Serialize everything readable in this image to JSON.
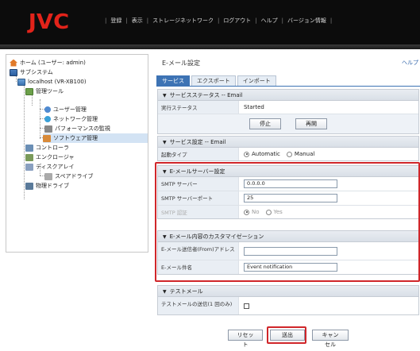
{
  "header": {
    "logo": "JVC",
    "nav": [
      "登録",
      "表示",
      "ストレージネットワーク",
      "ログアウト",
      "ヘルプ",
      "バージョン情報"
    ]
  },
  "tree": {
    "home": "ホーム (ユーザー: admin)",
    "system": "サブシステム",
    "server": "localhost (VR-XB100)",
    "mgmt_tools": "管理ツール",
    "user_mgmt": "ユーザー管理",
    "net_mgmt": "ネットワーク管理",
    "perf_monitor": "パフォーマンスの監視",
    "software_mgmt": "ソフトウェア管理",
    "controller": "コントローラ",
    "enclosure": "エンクロージャ",
    "disk_array": "ディスクアレイ",
    "spare_drive": "スペアドライブ",
    "physical_drive": "物理ドライブ"
  },
  "page": {
    "title": "E-メール設定",
    "help": "ヘルプ",
    "tabs": [
      "サービス",
      "エクスポート",
      "インポート"
    ]
  },
  "service_status": {
    "header": "サービスステータス -- Email",
    "status_label": "実行ステータス",
    "status_value": "Started",
    "stop": "停止",
    "restart": "再開"
  },
  "service_settings": {
    "header": "サービス設定 -- Email",
    "startup_label": "起動タイプ",
    "auto": "Automatic",
    "manual": "Manual"
  },
  "smtp": {
    "header": "E-メールサーバー設定",
    "server_label": "SMTP サーバー",
    "server_value": "0.0.0.0",
    "port_label": "SMTP サーバーポート",
    "port_value": "25",
    "auth_label": "SMTP 認証",
    "no": "No",
    "yes": "Yes"
  },
  "custom": {
    "header": "E-メール内容のカスタマイゼーション",
    "from_label": "E-メール送信者(From)アドレス",
    "from_value": "",
    "subject_label": "E-メール件名",
    "subject_value": "Event notification"
  },
  "test": {
    "header": "テストメール",
    "send_label": "テストメールの送信(1 回のみ)"
  },
  "buttons": {
    "reset": "リセット",
    "submit": "送出",
    "cancel": "キャンセル"
  },
  "colors": {
    "logo": "#e2231a",
    "highlight": "#d0262a",
    "tab_active": "#3d73b4"
  }
}
